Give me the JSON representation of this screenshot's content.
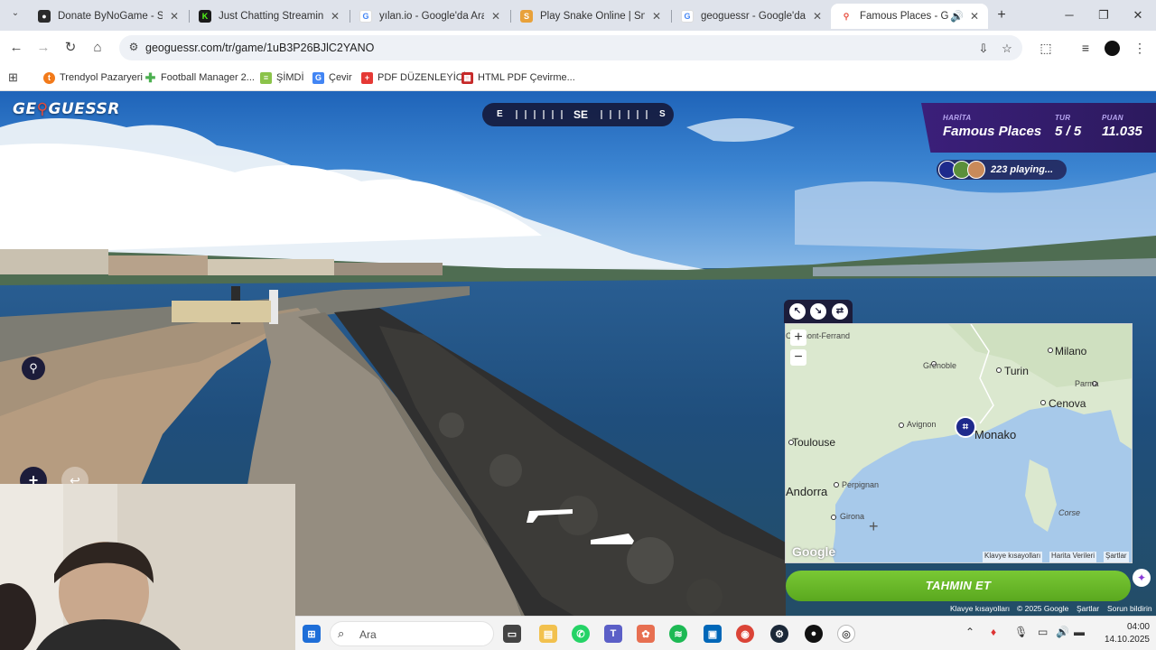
{
  "browser": {
    "tabs": [
      {
        "title": "Donate ByNoGame - Strea",
        "favicon": "bynogame-icon",
        "color": "#2b2b2b",
        "active": false
      },
      {
        "title": "Just Chatting Streaming - ",
        "favicon": "kick-icon",
        "color": "#53fc18",
        "active": false
      },
      {
        "title": "yılan.io - Google'da Ara",
        "favicon": "google-icon",
        "color": "#4285f4",
        "active": false
      },
      {
        "title": "Play Snake Online | Snake.",
        "favicon": "snake-icon",
        "color": "#e8a13a",
        "active": false
      },
      {
        "title": "geoguessr - Google'da Ara",
        "favicon": "google-icon",
        "color": "#4285f4",
        "active": false
      },
      {
        "title": "Famous Places - Game",
        "favicon": "geoguessr-pin-icon",
        "color": "#e74c3c",
        "active": true
      }
    ],
    "tab_close_glyph": "✕",
    "url": "geoguessr.com/tr/game/1uB3P26BJlC2YANO",
    "bookmarks": [
      {
        "label": "Trendyol Pazaryeri",
        "icon": "trendyol-icon",
        "color": "#f27a1a"
      },
      {
        "label": "Football Manager 2...",
        "icon": "plus-cross-icon",
        "color": "#4caf50"
      },
      {
        "label": "ŞİMDİ",
        "icon": "simdi-icon",
        "color": "#8bc34a"
      },
      {
        "label": "Çevir",
        "icon": "translate-icon",
        "color": "#4285f4"
      },
      {
        "label": "PDF DÜZENLEYİCİ",
        "icon": "pdf-icon",
        "color": "#e53935"
      },
      {
        "label": "HTML PDF Çevirme...",
        "icon": "pdf-grid-icon",
        "color": "#c62828"
      }
    ]
  },
  "game": {
    "logo_left": "GE",
    "logo_right": "GUESSR",
    "compass": {
      "left": "E",
      "center": "SE",
      "right": "S"
    },
    "panel": {
      "map_label": "HARİTA",
      "map_value": "Famous Places",
      "round_label": "TUR",
      "round_value": "5 / 5",
      "score_label": "PUAN",
      "score_value": "11.035"
    },
    "players": "223 playing...",
    "guess_button": "TAHMIN ET",
    "footer_links": [
      "Klavye kısayolları",
      "© 2025 Google",
      "Şartlar",
      "Sorun bildirin"
    ]
  },
  "minimap": {
    "cities": [
      {
        "name": "Milano",
        "size": "big"
      },
      {
        "name": "Turin",
        "size": "big"
      },
      {
        "name": "Grenoble",
        "size": "small"
      },
      {
        "name": "Parma",
        "size": "small"
      },
      {
        "name": "Cenova",
        "size": "big"
      },
      {
        "name": "Avignon",
        "size": "small"
      },
      {
        "name": "Monako",
        "size": "huge"
      },
      {
        "name": "Toulouse",
        "size": "big"
      },
      {
        "name": "Perpignan",
        "size": "small"
      },
      {
        "name": "Andorra",
        "size": "huge"
      },
      {
        "name": "Girona",
        "size": "small"
      },
      {
        "name": "Corse",
        "size": "small"
      },
      {
        "name": "Clermont-Ferrand",
        "size": "small"
      }
    ],
    "google_label": "Google",
    "footer": [
      "Klavye kısayolları",
      "Harita Verileri",
      "Şartlar"
    ],
    "zoom_in": "+",
    "zoom_out": "−"
  },
  "taskbar": {
    "search_placeholder": "Ara",
    "time": "04:00",
    "date": "14.10.2025"
  }
}
